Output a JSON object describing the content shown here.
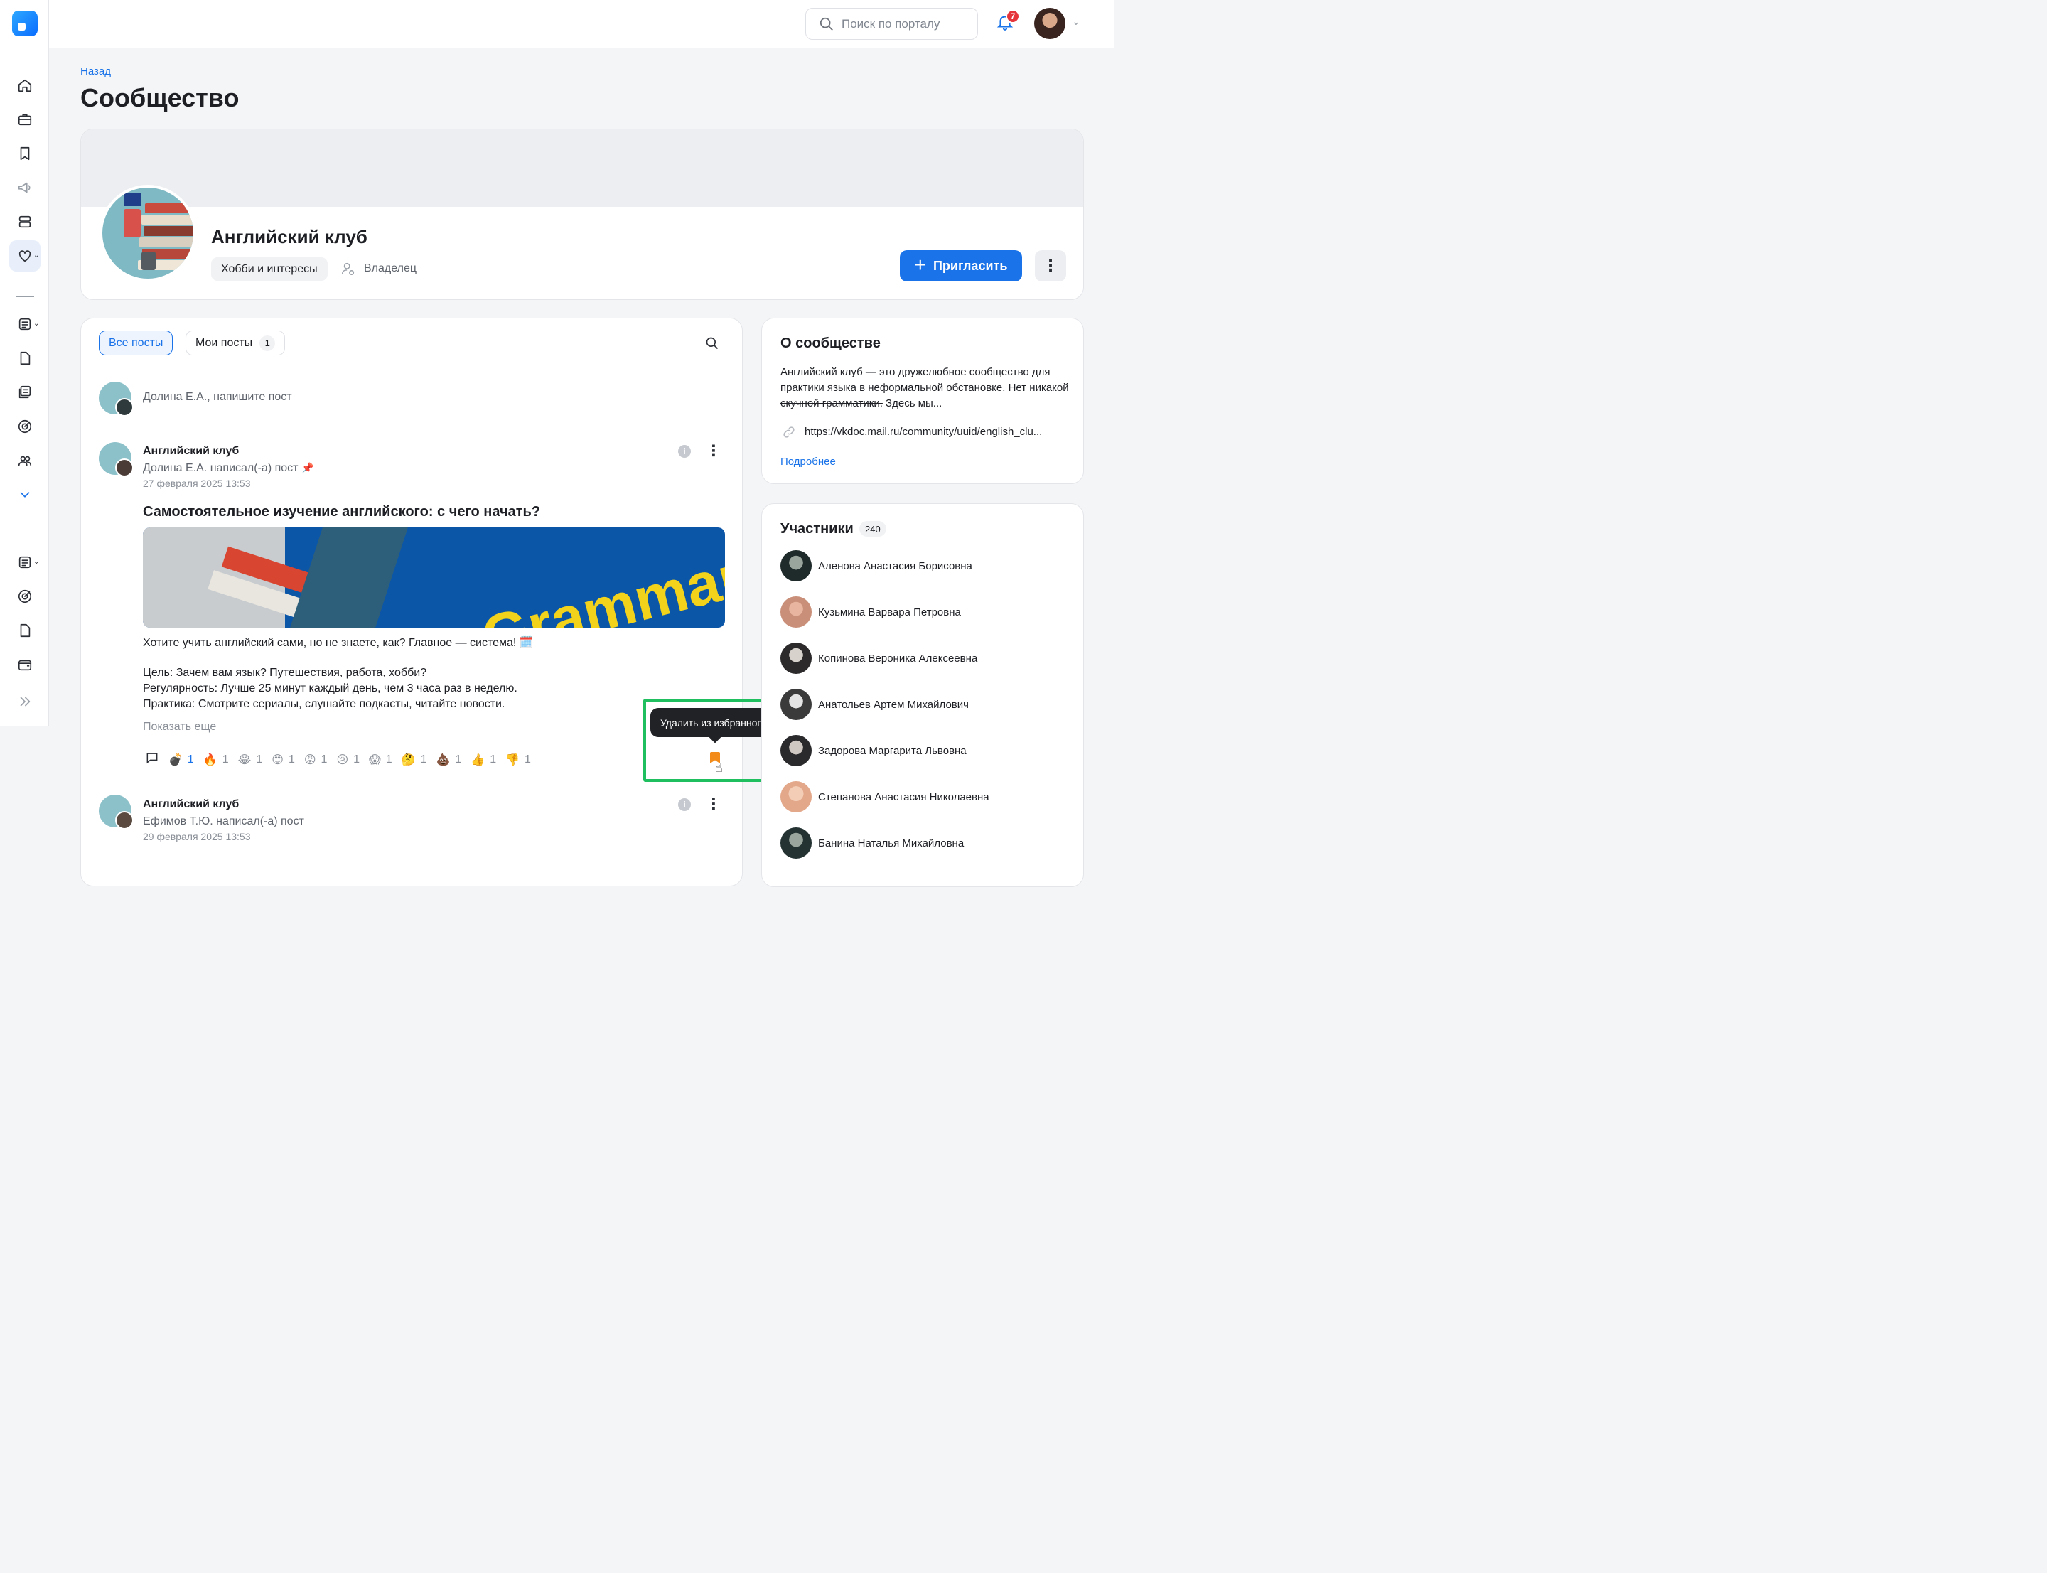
{
  "colors": {
    "accent": "#1a73e8",
    "badge": "#e5343a",
    "bookmark": "#f28b1a",
    "highlight": "#1fbf5f"
  },
  "header": {
    "search_placeholder": "Поиск по порталу",
    "notifications_count": "7"
  },
  "sidebar": {
    "icons": [
      "home-icon",
      "briefcase-icon",
      "bookmark-icon",
      "megaphone-icon",
      "server-icon",
      "community-icon",
      "document-icon",
      "file-icon",
      "news-icon",
      "target-icon",
      "users-icon",
      "chevron-down-icon",
      "document-icon",
      "target-icon",
      "file-icon",
      "wallet-icon",
      "expand-icon"
    ]
  },
  "breadcrumb": {
    "back": "Назад"
  },
  "page": {
    "title": "Сообщество"
  },
  "community": {
    "name": "Английский клуб",
    "category": "Хобби и интересы",
    "role": "Владелец",
    "invite_label": "Пригласить"
  },
  "tabs": {
    "all": "Все посты",
    "mine": "Мои посты",
    "mine_count": "1"
  },
  "composer": {
    "placeholder": "Долина Е.А., напишите пост"
  },
  "posts": [
    {
      "author": "Английский клуб",
      "subtitle": "Долина Е.А. написал(-а) пост",
      "date": "27 февраля 2025 13:53",
      "title": "Самостоятельное изучение английского: с чего начать?",
      "body_line1": "Хотите учить английский сами, но не знаете, как? Главное — система! 🗓️",
      "body_line2": "Цель: Зачем вам язык? Путешествия, работа, хобби?",
      "body_line3": "Регулярность: Лучше 25 минут каждый день, чем 3 часа раз в неделю.",
      "body_line4": "Практика: Смотрите сериалы, слушайте подкасты, читайте новости.",
      "show_more": "Показать еще",
      "reactions": [
        {
          "emoji": "💣",
          "count": "1"
        },
        {
          "emoji": "🔥",
          "count": "1"
        },
        {
          "emoji": "😂",
          "count": "1"
        },
        {
          "emoji": "😍",
          "count": "1"
        },
        {
          "emoji": "😡",
          "count": "1"
        },
        {
          "emoji": "😢",
          "count": "1"
        },
        {
          "emoji": "😱",
          "count": "1"
        },
        {
          "emoji": "🤔",
          "count": "1"
        },
        {
          "emoji": "💩",
          "count": "1"
        },
        {
          "emoji": "👍",
          "count": "1"
        },
        {
          "emoji": "👎",
          "count": "1"
        }
      ]
    },
    {
      "author": "Английский клуб",
      "subtitle": "Ефимов Т.Ю. написал(-а) пост",
      "date": "29 февраля 2025 13:53"
    }
  ],
  "tooltip": {
    "text": "Удалить из избранного"
  },
  "about": {
    "title": "О сообществе",
    "text_before": "Английский клуб — это дружелюбное сообщество для практики языка в неформальной обстановке. Нет никакой ",
    "text_strike": "скучной грамматики.",
    "text_after": " Здесь мы...",
    "url": "https://vkdoc.mail.ru/community/uuid/english_clu...",
    "more": "Подробнее"
  },
  "members": {
    "title": "Участники",
    "count": "240",
    "list": [
      "Аленова Анастасия Борисовна",
      "Кузьмина Варвара Петровна",
      "Копинова Вероника Алексеевна",
      "Анатольев Артем Михайлович",
      "Задорова Маргарита Львовна",
      "Степанова Анастасия Николаевна",
      "Банина Наталья Михайловна"
    ]
  }
}
